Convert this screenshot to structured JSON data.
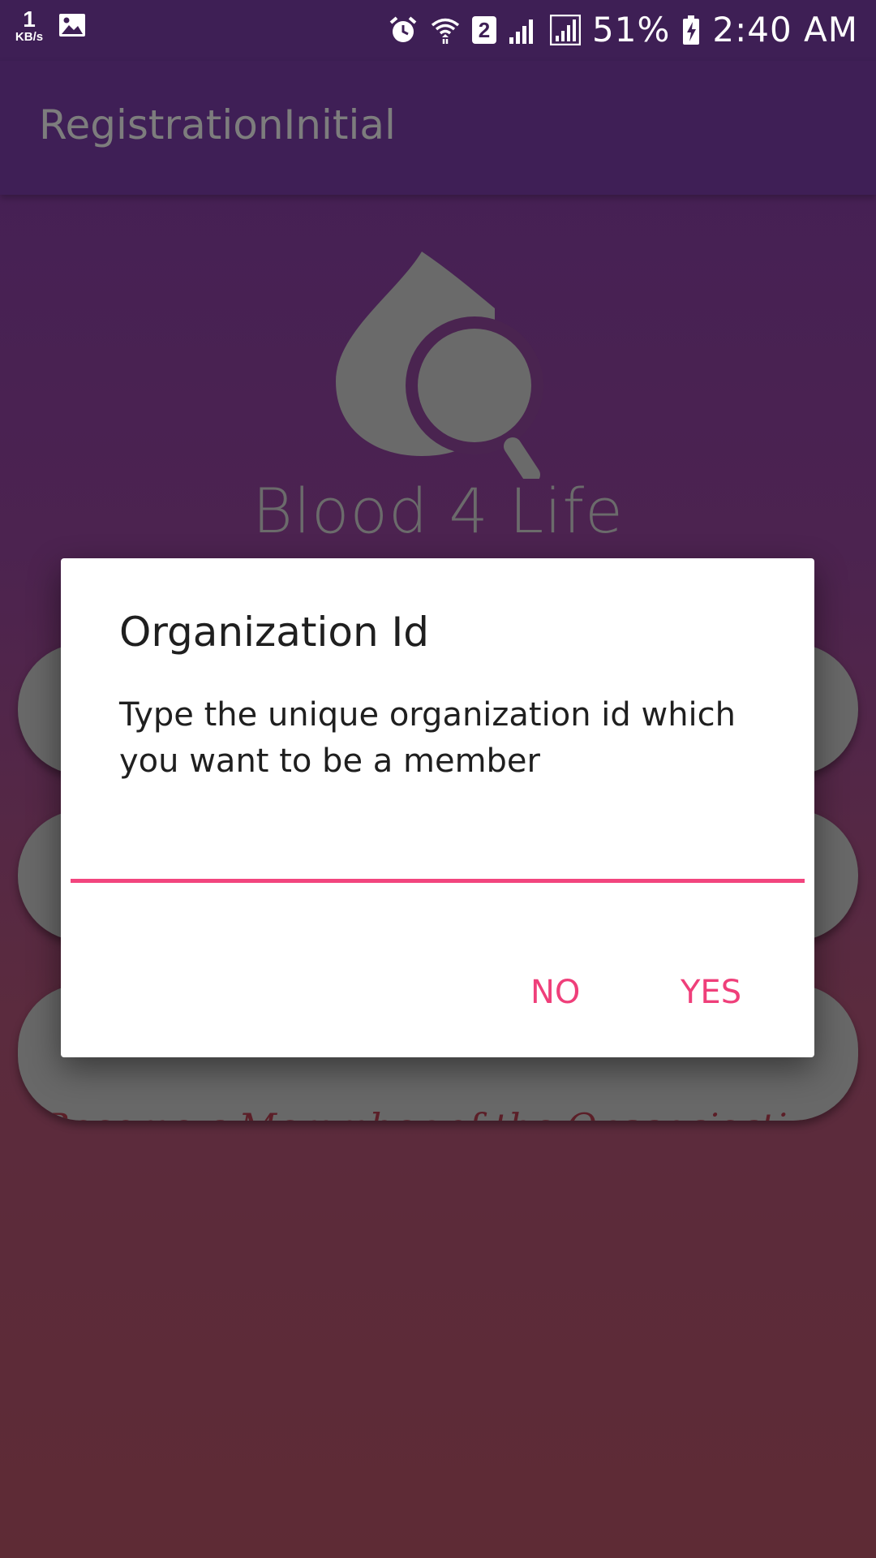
{
  "status_bar": {
    "net_speed_value": "1",
    "net_speed_unit": "KB/s",
    "sim_badge": "2",
    "battery_percent": "51%",
    "time": "2:40 AM",
    "icons": [
      "image-icon",
      "alarm-icon",
      "wifi-icon",
      "signal-icon",
      "battery-charging-icon"
    ]
  },
  "app_bar": {
    "title": "RegistrationInitial"
  },
  "logo": {
    "text": "Blood 4 Life",
    "icon": "blood-drop-search-icon"
  },
  "background": {
    "button_3_label": "Become a Memmber of the Organaisation"
  },
  "dialog": {
    "title": "Organization Id",
    "message": "Type the unique organization id which you want to be a member",
    "input_value": "",
    "no_label": "NO",
    "yes_label": "YES"
  },
  "colors": {
    "primary_dark": "#3e1f55",
    "accent": "#ef3f7a",
    "pill_gray": "#686868"
  }
}
